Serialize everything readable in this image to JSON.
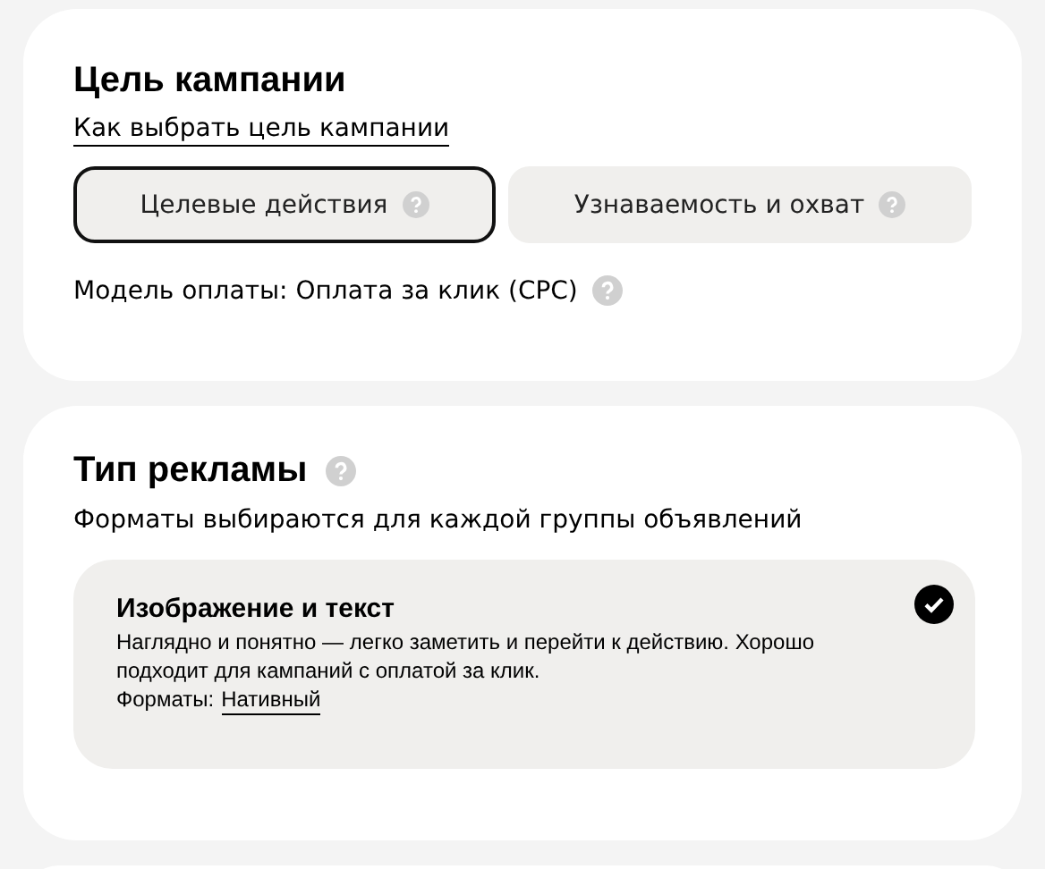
{
  "goal_section": {
    "title": "Цель кампании",
    "help_link": "Как выбрать цель кампании",
    "options": [
      {
        "label": "Целевые действия",
        "selected": true
      },
      {
        "label": "Узнаваемость и охват",
        "selected": false
      }
    ],
    "payment_model": "Модель оплаты: Оплата за клик (CPC)"
  },
  "ad_type_section": {
    "title": "Тип рекламы",
    "subtitle": "Форматы выбираются для каждой группы объявлений",
    "options": [
      {
        "title": "Изображение и текст",
        "description": "Наглядно и понятно — легко заметить и перейти к действию. Хорошо подходит для кампаний с оплатой за клик.",
        "formats_label": "Форматы:",
        "format_link": "Нативный",
        "selected": true
      }
    ]
  }
}
